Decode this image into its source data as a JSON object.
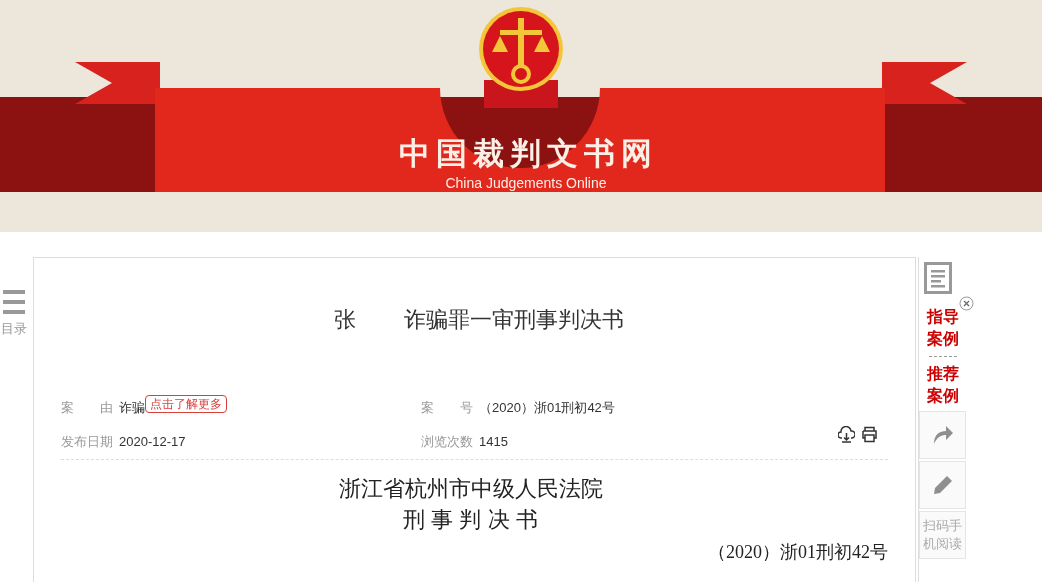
{
  "header": {
    "title": "中国裁判文书网",
    "subtitle": "China Judgements Online"
  },
  "left_sidebar": {
    "label": "目录"
  },
  "document": {
    "title_parts": [
      "张",
      "诈骗罪一审刑事判决书"
    ],
    "meta": [
      {
        "label": "案　　由",
        "value": "诈骗",
        "link": "点击了解更多"
      },
      {
        "label": "案　　号",
        "value": "（2020）浙01刑初42号"
      },
      {
        "label": "发布日期",
        "value": "2020-12-17"
      },
      {
        "label": "浏览次数",
        "value": "1415"
      }
    ],
    "court": "浙江省杭州市中级人民法院",
    "doc_type": "刑 事 判 决 书",
    "case_number": "（2020）浙01刑初42号"
  },
  "right_panel": {
    "links": [
      "指导案例",
      "推荐案例"
    ],
    "tools": [
      {
        "kind": "share"
      },
      {
        "kind": "edit"
      },
      {
        "kind": "text",
        "label": "扫码手机阅读"
      }
    ]
  }
}
